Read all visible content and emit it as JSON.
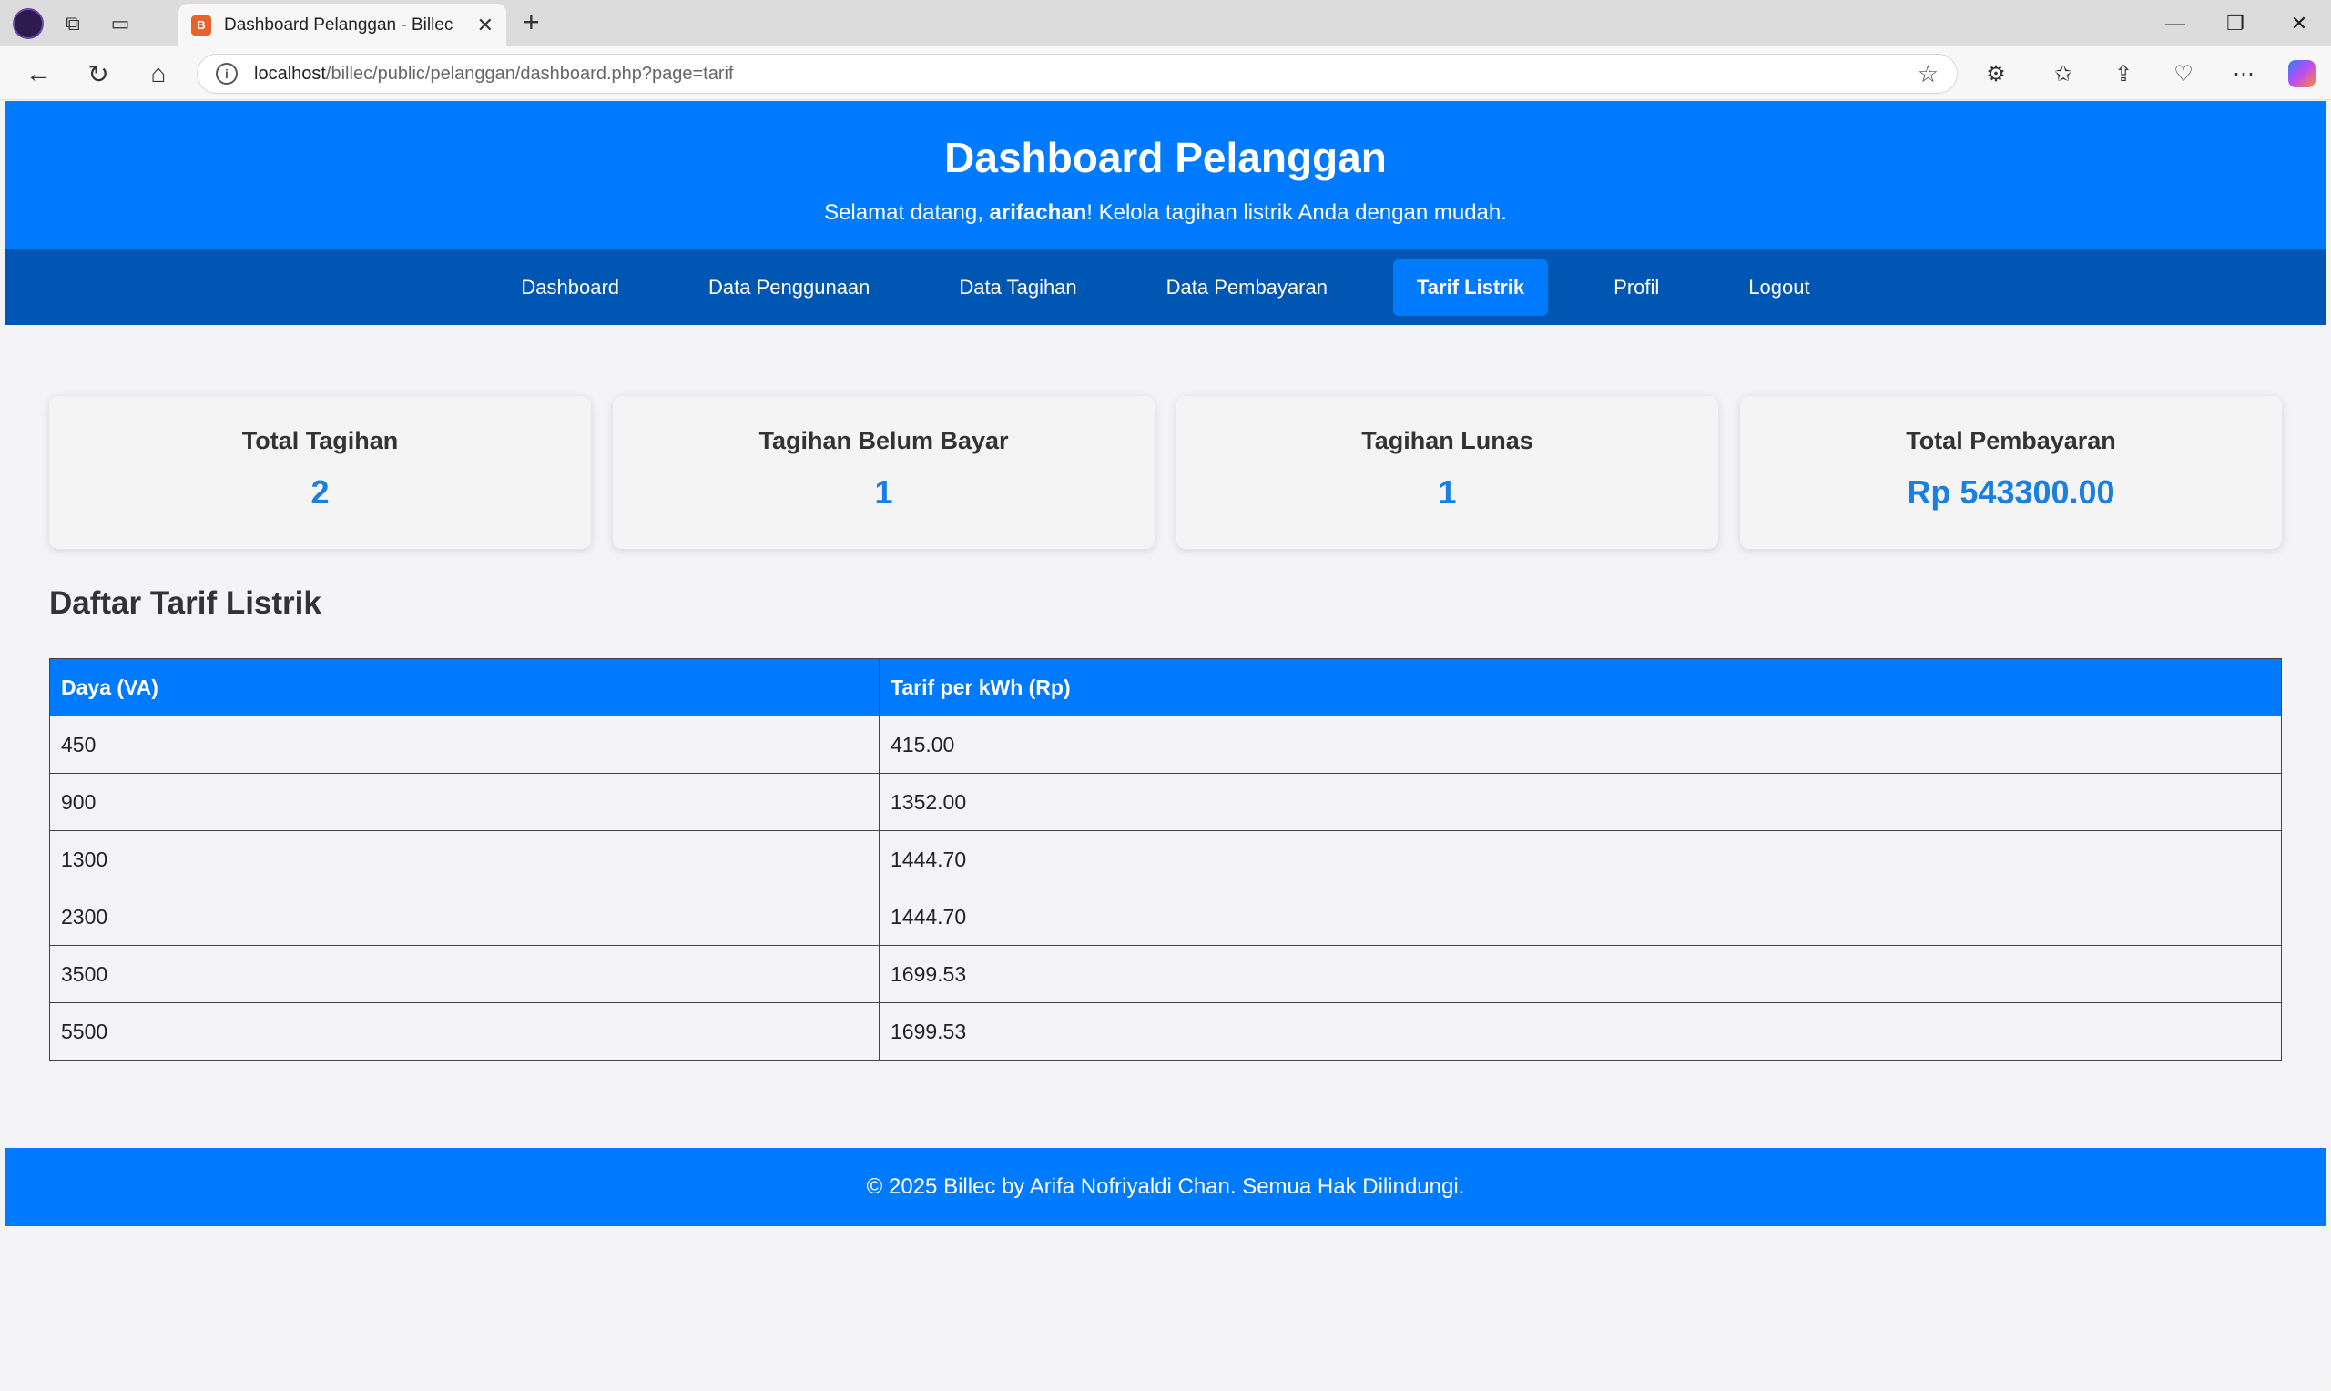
{
  "browser": {
    "tab_title": "Dashboard Pelanggan - Billec",
    "url_host": "localhost",
    "url_path": "/billec/public/pelanggan/dashboard.php?page=tarif"
  },
  "header": {
    "title": "Dashboard Pelanggan",
    "greeting_prefix": "Selamat datang, ",
    "username": "arifachan",
    "greeting_suffix": "! Kelola tagihan listrik Anda dengan mudah."
  },
  "nav": {
    "items": [
      {
        "label": "Dashboard",
        "active": false
      },
      {
        "label": "Data Penggunaan",
        "active": false
      },
      {
        "label": "Data Tagihan",
        "active": false
      },
      {
        "label": "Data Pembayaran",
        "active": false
      },
      {
        "label": "Tarif Listrik",
        "active": true
      },
      {
        "label": "Profil",
        "active": false
      },
      {
        "label": "Logout",
        "active": false
      }
    ]
  },
  "cards": [
    {
      "label": "Total Tagihan",
      "value": "2"
    },
    {
      "label": "Tagihan Belum Bayar",
      "value": "1"
    },
    {
      "label": "Tagihan Lunas",
      "value": "1"
    },
    {
      "label": "Total Pembayaran",
      "value": "Rp 543300.00"
    }
  ],
  "tarif": {
    "title": "Daftar Tarif Listrik",
    "columns": [
      "Daya (VA)",
      "Tarif per kWh (Rp)"
    ],
    "rows": [
      [
        "450",
        "415.00"
      ],
      [
        "900",
        "1352.00"
      ],
      [
        "1300",
        "1444.70"
      ],
      [
        "2300",
        "1444.70"
      ],
      [
        "3500",
        "1699.53"
      ],
      [
        "5500",
        "1699.53"
      ]
    ]
  },
  "footer": {
    "text": "© 2025 Billec by Arifa Nofriyaldi Chan. Semua Hak Dilindungi."
  },
  "colors": {
    "primary": "#007bff",
    "nav_bg": "#0056b3",
    "card_value": "#1a7fe0"
  }
}
